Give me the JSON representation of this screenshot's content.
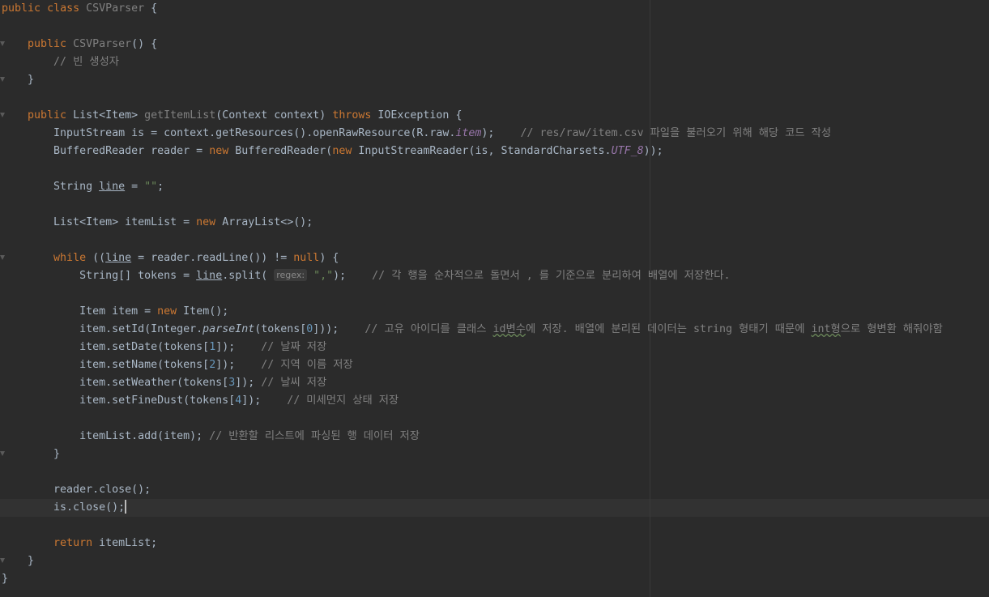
{
  "editor": {
    "theme_colors": {
      "background": "#2b2b2b",
      "keyword": "#cc7832",
      "method": "#ffc66d",
      "comment": "#808080",
      "string": "#6a8759",
      "number": "#6897bb",
      "field": "#9876aa",
      "text": "#a9b7c6"
    },
    "param_hint": "regex:",
    "lines": [
      {
        "tokens": [
          [
            "kw",
            "public"
          ],
          [
            "p",
            " "
          ],
          [
            "kw",
            "class"
          ],
          [
            "p",
            " "
          ],
          [
            "gray",
            "CSVParser"
          ],
          [
            "p",
            " {"
          ]
        ],
        "fold": false
      },
      {
        "tokens": [],
        "fold": false
      },
      {
        "tokens": [
          [
            "p",
            "    "
          ],
          [
            "kw",
            "public"
          ],
          [
            "p",
            " "
          ],
          [
            "gray",
            "CSVParser"
          ],
          [
            "p",
            "() {"
          ]
        ],
        "fold": true
      },
      {
        "tokens": [
          [
            "p",
            "        "
          ],
          [
            "cm",
            "// 빈 생성자"
          ]
        ],
        "fold": false
      },
      {
        "tokens": [
          [
            "p",
            "    }"
          ]
        ],
        "fold": true
      },
      {
        "tokens": [],
        "fold": false
      },
      {
        "tokens": [
          [
            "p",
            "    "
          ],
          [
            "kw",
            "public"
          ],
          [
            "p",
            " List<Item> "
          ],
          [
            "gray",
            "getItemList"
          ],
          [
            "p",
            "(Context context) "
          ],
          [
            "kw",
            "throws"
          ],
          [
            "p",
            " IOException {"
          ]
        ],
        "fold": true
      },
      {
        "tokens": [
          [
            "p",
            "        InputStream is = context.getResources().openRawResource(R.raw."
          ],
          [
            "fld",
            "item"
          ],
          [
            "p",
            ");    "
          ],
          [
            "cm",
            "// res/raw/item.csv 파일을 불러오기 위해 해당 코드 작성"
          ]
        ],
        "fold": false
      },
      {
        "tokens": [
          [
            "p",
            "        BufferedReader reader = "
          ],
          [
            "kw",
            "new"
          ],
          [
            "p",
            " BufferedReader("
          ],
          [
            "kw",
            "new"
          ],
          [
            "p",
            " InputStreamReader(is, StandardCharsets."
          ],
          [
            "fld",
            "UTF_8"
          ],
          [
            "p",
            "));"
          ]
        ],
        "fold": false
      },
      {
        "tokens": [],
        "fold": false
      },
      {
        "tokens": [
          [
            "p",
            "        String "
          ],
          [
            "ul",
            "line"
          ],
          [
            "p",
            " = "
          ],
          [
            "str",
            "\"\""
          ],
          [
            "p",
            ";"
          ]
        ],
        "fold": false
      },
      {
        "tokens": [],
        "fold": false
      },
      {
        "tokens": [
          [
            "p",
            "        List<Item> itemList = "
          ],
          [
            "kw",
            "new"
          ],
          [
            "p",
            " ArrayList<>();"
          ]
        ],
        "fold": false
      },
      {
        "tokens": [],
        "fold": false
      },
      {
        "tokens": [
          [
            "p",
            "        "
          ],
          [
            "kw",
            "while"
          ],
          [
            "p",
            " (("
          ],
          [
            "ul",
            "line"
          ],
          [
            "p",
            " = reader.readLine()) != "
          ],
          [
            "kw",
            "null"
          ],
          [
            "p",
            ") {"
          ]
        ],
        "fold": true
      },
      {
        "tokens": [
          [
            "p",
            "            String[] tokens = "
          ],
          [
            "ul",
            "line"
          ],
          [
            "p",
            ".split( "
          ],
          [
            "hint",
            "regex:"
          ],
          [
            "p",
            " "
          ],
          [
            "str",
            "\",\""
          ],
          [
            "p",
            ");    "
          ],
          [
            "cm",
            "// 각 행을 순차적으로 돌면서 , 를 기준으로 분리하여 배열에 저장한다."
          ]
        ],
        "fold": false
      },
      {
        "tokens": [],
        "fold": false
      },
      {
        "tokens": [
          [
            "p",
            "            Item item = "
          ],
          [
            "kw",
            "new"
          ],
          [
            "p",
            " Item();"
          ]
        ],
        "fold": false
      },
      {
        "tokens": [
          [
            "p",
            "            item.setId(Integer."
          ],
          [
            "it",
            "parseInt"
          ],
          [
            "p",
            "(tokens["
          ],
          [
            "num",
            "0"
          ],
          [
            "p",
            "]));    "
          ],
          [
            "cm",
            "// 고유 아이디를 클래스 "
          ],
          [
            "cmw",
            "id변수"
          ],
          [
            "cm",
            "에 저장. 배열에 분리된 데이터는 string 형태기 때문에 "
          ],
          [
            "cmw",
            "int형"
          ],
          [
            "cm",
            "으로 형변환 해줘야함"
          ]
        ],
        "fold": false
      },
      {
        "tokens": [
          [
            "p",
            "            item.setDate(tokens["
          ],
          [
            "num",
            "1"
          ],
          [
            "p",
            "]);    "
          ],
          [
            "cm",
            "// 날짜 저장"
          ]
        ],
        "fold": false
      },
      {
        "tokens": [
          [
            "p",
            "            item.setName(tokens["
          ],
          [
            "num",
            "2"
          ],
          [
            "p",
            "]);    "
          ],
          [
            "cm",
            "// 지역 이름 저장"
          ]
        ],
        "fold": false
      },
      {
        "tokens": [
          [
            "p",
            "            item.setWeather(tokens["
          ],
          [
            "num",
            "3"
          ],
          [
            "p",
            "]); "
          ],
          [
            "cm",
            "// 날씨 저장"
          ]
        ],
        "fold": false
      },
      {
        "tokens": [
          [
            "p",
            "            item.setFineDust(tokens["
          ],
          [
            "num",
            "4"
          ],
          [
            "p",
            "]);    "
          ],
          [
            "cm",
            "// 미세먼지 상태 저장"
          ]
        ],
        "fold": false
      },
      {
        "tokens": [],
        "fold": false
      },
      {
        "tokens": [
          [
            "p",
            "            itemList.add(item); "
          ],
          [
            "cm",
            "// 반환할 리스트에 파싱된 행 데이터 저장"
          ]
        ],
        "fold": false
      },
      {
        "tokens": [
          [
            "p",
            "        }"
          ]
        ],
        "fold": true
      },
      {
        "tokens": [],
        "fold": false
      },
      {
        "tokens": [
          [
            "p",
            "        reader.close();"
          ]
        ],
        "fold": false
      },
      {
        "tokens": [
          [
            "p",
            "        is.close();"
          ],
          [
            "caret",
            ""
          ]
        ],
        "fold": false,
        "current": true
      },
      {
        "tokens": [],
        "fold": false
      },
      {
        "tokens": [
          [
            "p",
            "        "
          ],
          [
            "kw",
            "return"
          ],
          [
            "p",
            " itemList;"
          ]
        ],
        "fold": false
      },
      {
        "tokens": [
          [
            "p",
            "    }"
          ]
        ],
        "fold": true
      },
      {
        "tokens": [
          [
            "p",
            "}"
          ]
        ],
        "fold": false
      }
    ]
  }
}
